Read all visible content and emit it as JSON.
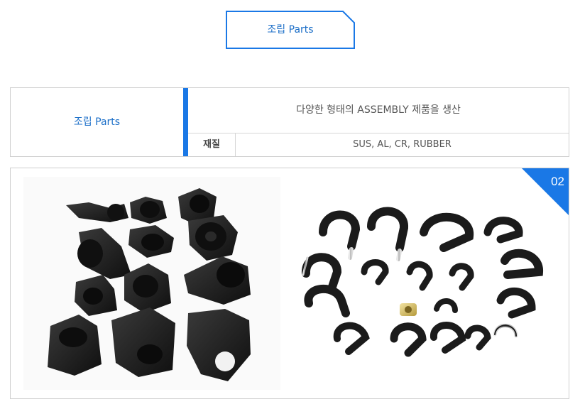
{
  "title_badge": {
    "label": "조립 Parts"
  },
  "spec": {
    "category": "조립 Parts",
    "description": "다양한 형태의 ASSEMBLY 제품을 생산",
    "material_label": "재질",
    "material_value": "SUS, AL, CR, RUBBER"
  },
  "photo": {
    "number": "02",
    "left_group": "rubber-mount-brackets",
    "right_group": "cushioned-p-clamps"
  },
  "colors": {
    "accent_blue": "#1a78e6",
    "text_blue": "#1c6fc8",
    "border_gray": "#cfcfcf",
    "part_black": "#1b1b1b"
  }
}
